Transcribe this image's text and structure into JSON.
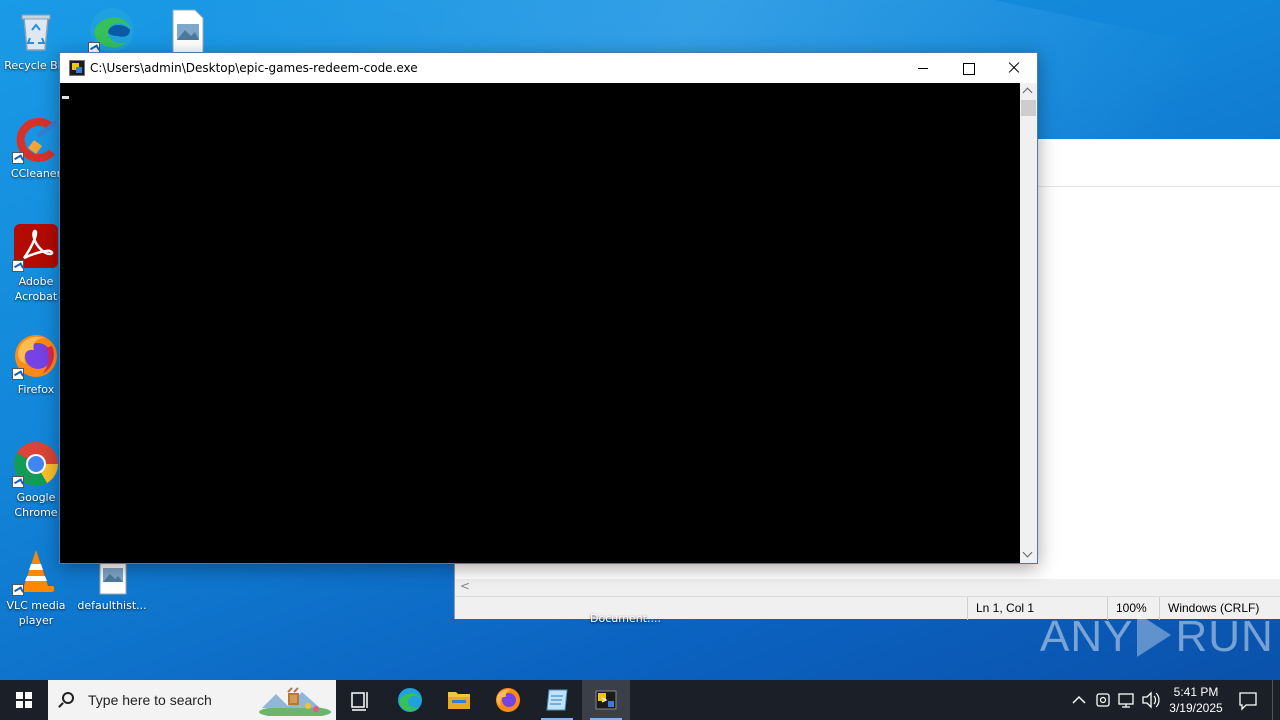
{
  "desktop": {
    "icons": [
      {
        "label": "Recycle Bin",
        "icon": "recycle-bin-icon"
      },
      {
        "label": "CCleaner",
        "icon": "ccleaner-icon"
      },
      {
        "label": "Adobe Acrobat",
        "icon": "adobe-acrobat-icon"
      },
      {
        "label": "Firefox",
        "icon": "firefox-icon"
      },
      {
        "label": "Google Chrome",
        "icon": "chrome-icon"
      },
      {
        "label": "VLC media player",
        "icon": "vlc-icon"
      },
      {
        "label": "defaulthist...",
        "icon": "image-file-icon"
      },
      {
        "label": "",
        "icon": "edge-icon"
      },
      {
        "label": "",
        "icon": "image-file-icon"
      }
    ],
    "partial_label": "Document...."
  },
  "console": {
    "title": "C:\\Users\\admin\\Desktop\\epic-games-redeem-code.exe",
    "body_color": "#000000"
  },
  "notepad": {
    "status": {
      "position": "Ln 1, Col 1",
      "zoom": "100%",
      "line_ending": "Windows (CRLF)"
    },
    "hscroll_arrow": "<"
  },
  "watermark": {
    "left": "ANY",
    "right": "RUN"
  },
  "taskbar": {
    "search_placeholder": "Type here to search",
    "apps": [
      "task-view-icon",
      "edge-icon",
      "file-explorer-icon",
      "firefox-icon",
      "notepad-icon",
      "console-app-icon"
    ],
    "clock_time": "5:41 PM",
    "clock_date": "3/19/2025"
  },
  "colors": {
    "taskbar": "#1b1f27",
    "desktop": "#1285d8",
    "accent": "#7fb4f0"
  }
}
